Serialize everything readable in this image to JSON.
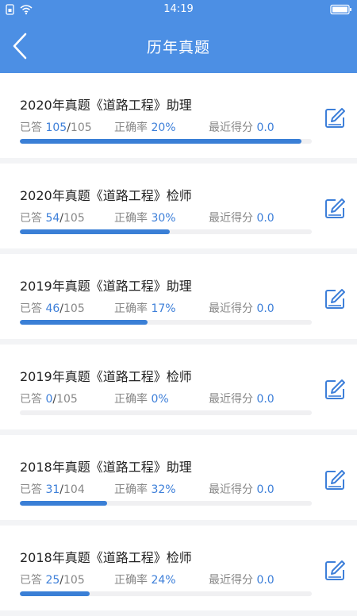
{
  "status_bar": {
    "time": "14:19"
  },
  "header": {
    "title": "历年真题"
  },
  "labels": {
    "answered": "已答",
    "accuracy": "正确率",
    "score": "最近得分"
  },
  "papers": [
    {
      "title": "2020年真题《道路工程》助理",
      "answered": "105",
      "total": "105",
      "accuracy": "20%",
      "score": "0.0",
      "progress": 0.965
    },
    {
      "title": "2020年真题《道路工程》检师",
      "answered": "54",
      "total": "105",
      "accuracy": "30%",
      "score": "0.0",
      "progress": 0.514
    },
    {
      "title": "2019年真题《道路工程》助理",
      "answered": "46",
      "total": "105",
      "accuracy": "17%",
      "score": "0.0",
      "progress": 0.438
    },
    {
      "title": "2019年真题《道路工程》检师",
      "answered": "0",
      "total": "105",
      "accuracy": "0%",
      "score": "0.0",
      "progress": 0
    },
    {
      "title": "2018年真题《道路工程》助理",
      "answered": "31",
      "total": "104",
      "accuracy": "32%",
      "score": "0.0",
      "progress": 0.298
    },
    {
      "title": "2018年真题《道路工程》检师",
      "answered": "25",
      "total": "105",
      "accuracy": "24%",
      "score": "0.0",
      "progress": 0.238
    }
  ]
}
